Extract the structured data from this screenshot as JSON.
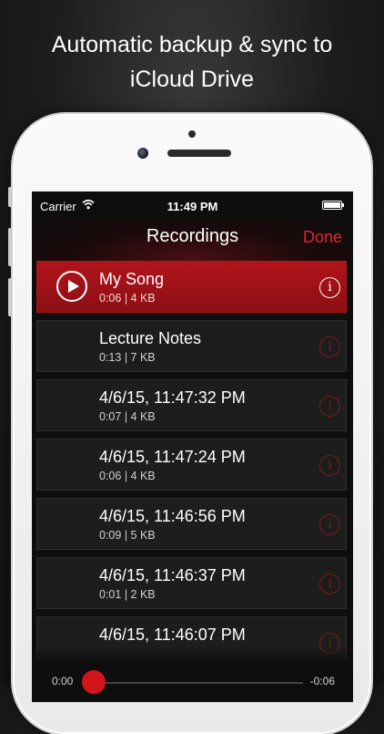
{
  "headline": {
    "line1": "Automatic backup & sync to",
    "line2": "iCloud Drive"
  },
  "status_bar": {
    "carrier": "Carrier",
    "time": "11:49 PM"
  },
  "nav": {
    "title": "Recordings",
    "done_label": "Done"
  },
  "recordings": [
    {
      "title": "My Song",
      "duration": "0:06",
      "size": "4 KB",
      "playing": true
    },
    {
      "title": "Lecture Notes",
      "duration": "0:13",
      "size": "7 KB",
      "playing": false
    },
    {
      "title": "4/6/15, 11:47:32 PM",
      "duration": "0:07",
      "size": "4 KB",
      "playing": false
    },
    {
      "title": "4/6/15, 11:47:24 PM",
      "duration": "0:06",
      "size": "4 KB",
      "playing": false
    },
    {
      "title": "4/6/15, 11:46:56 PM",
      "duration": "0:09",
      "size": "5 KB",
      "playing": false
    },
    {
      "title": "4/6/15, 11:46:37 PM",
      "duration": "0:01",
      "size": "2 KB",
      "playing": false
    },
    {
      "title": "4/6/15, 11:46:07 PM",
      "duration": "",
      "size": "",
      "playing": false
    }
  ],
  "player": {
    "elapsed": "0:00",
    "remaining": "-0:06"
  },
  "colors": {
    "accent": "#d3141b",
    "active_row": "#a31218",
    "info_inactive": "#7a1a1d"
  },
  "icons": {
    "play": "play-icon",
    "info": "info-icon",
    "wifi": "wifi-icon",
    "battery": "battery-icon"
  }
}
